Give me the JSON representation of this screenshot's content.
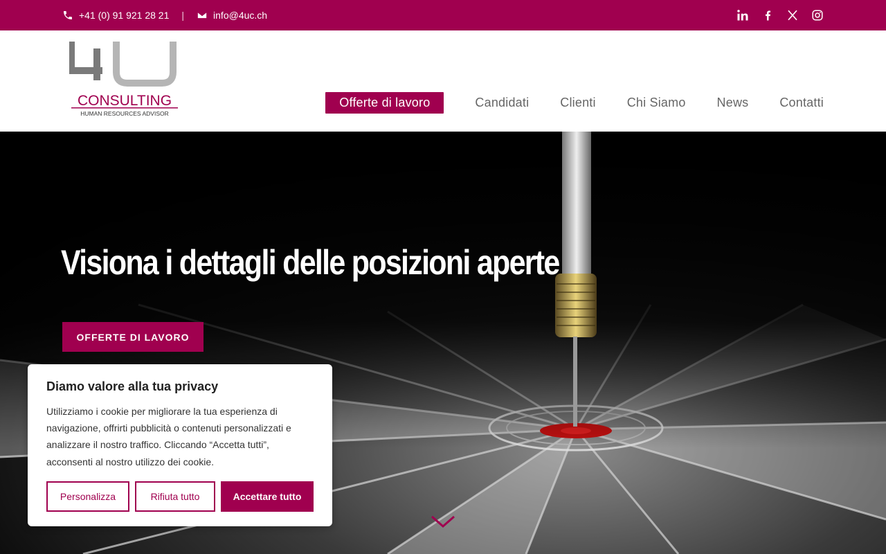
{
  "topbar": {
    "phone": "+41 (0) 91 921 28 21",
    "separator": "|",
    "email": "info@4uc.ch",
    "social_icons": [
      "linkedin-icon",
      "facebook-icon",
      "x-icon",
      "instagram-icon"
    ]
  },
  "logo": {
    "mark": "4U",
    "name": "CONSULTING",
    "tagline": "HUMAN RESOURCES ADVISOR"
  },
  "nav": {
    "items": [
      {
        "label": "Offerte di lavoro",
        "active": true
      },
      {
        "label": "Candidati"
      },
      {
        "label": "Clienti"
      },
      {
        "label": "Chi Siamo"
      },
      {
        "label": "News"
      },
      {
        "label": "Contatti"
      }
    ]
  },
  "hero": {
    "title": "Visiona i dettagli delle posizioni aperte",
    "cta_label": "OFFERTE DI LAVORO"
  },
  "cookie": {
    "title": "Diamo valore alla tua privacy",
    "text": "Utilizziamo i cookie per migliorare la tua esperienza di navigazione, offrirti pubblicità o contenuti personalizzati e analizzare il nostro traffico. Cliccando “Accetta tutti”, acconsenti al nostro utilizzo dei cookie.",
    "customize_label": "Personalizza",
    "reject_label": "Rifiuta tutto",
    "accept_label": "Accettare tutto"
  },
  "colors": {
    "brand": "#a0004f",
    "logo_grey": "#7a7a7a"
  }
}
